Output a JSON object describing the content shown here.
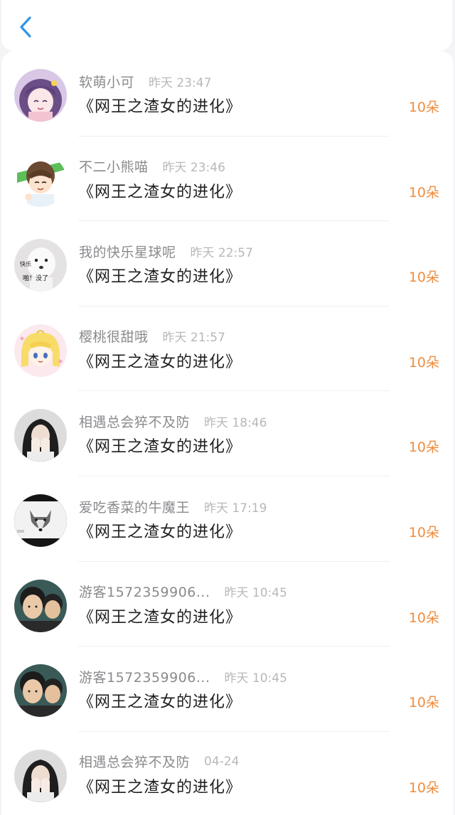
{
  "header": {
    "back_icon": "chevron-left-icon",
    "accent_color": "#2f95e8"
  },
  "gift_color": "#f08c3c",
  "records": [
    {
      "username": "软萌小可",
      "time": "昨天 23:47",
      "gift": "《网王之渣女的进化》",
      "count": "10朵",
      "avatar_icon": "anime-girl-avatar"
    },
    {
      "username": "不二小熊喵",
      "time": "昨天 23:46",
      "gift": "《网王之渣女的进化》",
      "count": "10朵",
      "avatar_icon": "anime-boy-avatar"
    },
    {
      "username": "我的快乐星球呢",
      "time": "昨天 22:57",
      "gift": "《网王之渣女的进化》",
      "count": "10朵",
      "avatar_icon": "dog-meme-avatar",
      "avatar_text": [
        "快乐",
        "啪！没了"
      ]
    },
    {
      "username": "樱桃很甜哦",
      "time": "昨天 21:57",
      "gift": "《网王之渣女的进化》",
      "count": "10朵",
      "avatar_icon": "sailor-moon-avatar"
    },
    {
      "username": "相遇总会猝不及防",
      "time": "昨天 18:46",
      "gift": "《网王之渣女的进化》",
      "count": "10朵",
      "avatar_icon": "girl-photo-avatar"
    },
    {
      "username": "爱吃香菜的牛魔王",
      "time": "昨天 17:19",
      "gift": "《网王之渣女的进化》",
      "count": "10朵",
      "avatar_icon": "wolf-drawing-avatar"
    },
    {
      "username": "游客1572359906...",
      "time": "昨天 10:45",
      "gift": "《网王之渣女的进化》",
      "count": "10朵",
      "avatar_icon": "two-boys-photo-avatar"
    },
    {
      "username": "游客1572359906...",
      "time": "昨天 10:45",
      "gift": "《网王之渣女的进化》",
      "count": "10朵",
      "avatar_icon": "two-boys-photo-avatar"
    },
    {
      "username": "相遇总会猝不及防",
      "time": "04-24",
      "gift": "《网王之渣女的进化》",
      "count": "10朵",
      "avatar_icon": "girl-photo-avatar"
    }
  ]
}
